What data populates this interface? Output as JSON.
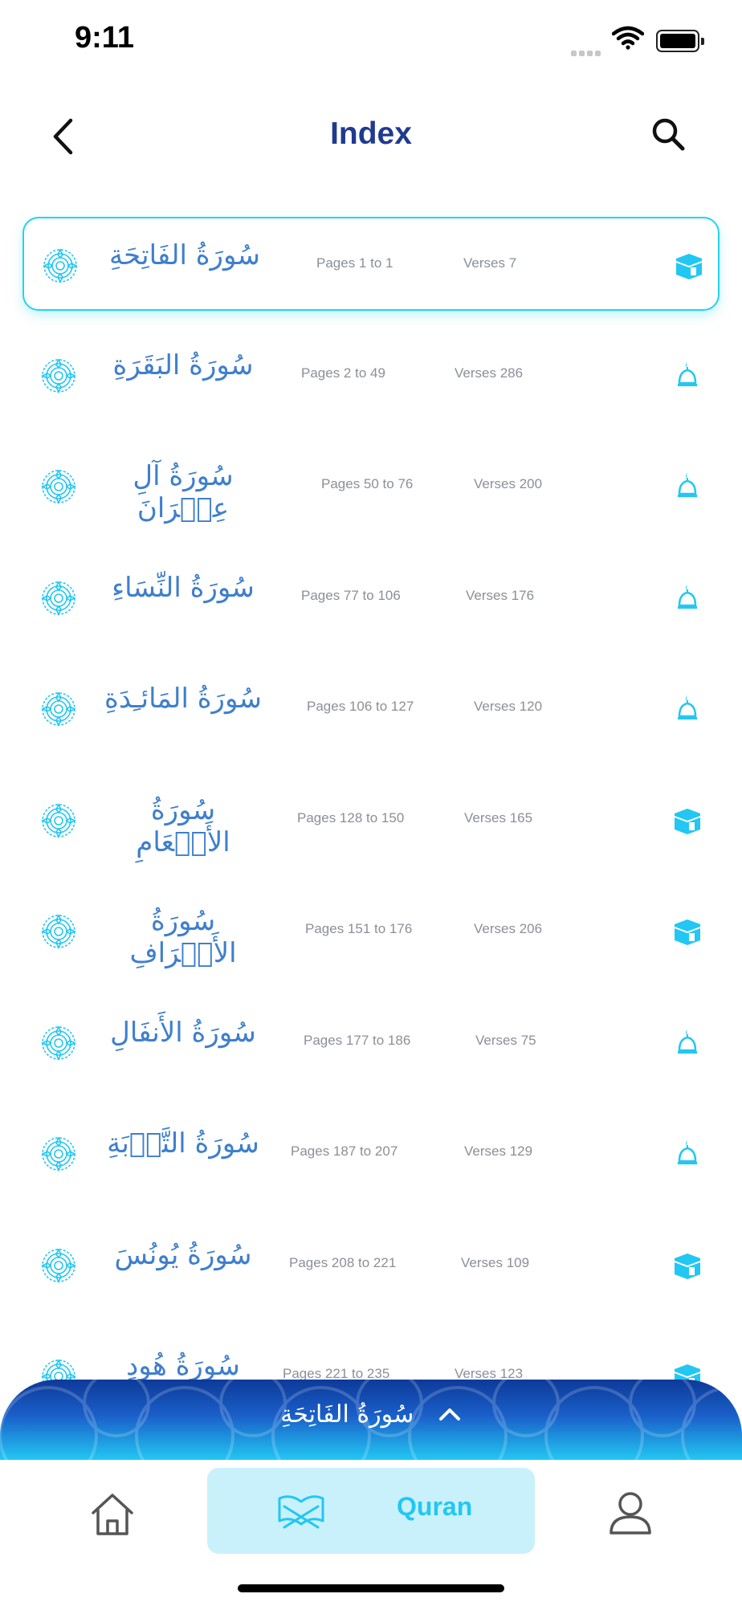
{
  "status_bar": {
    "time": "9:11"
  },
  "header": {
    "title": "Index"
  },
  "colors": {
    "accent": "#22c7f3",
    "title": "#1f3a8f",
    "surah_name": "#3f7fcc",
    "meta": "#8a8f98"
  },
  "surahs": [
    {
      "name": "سُورَةُ الفَاتِحَةِ",
      "pages": "Pages 1 to 1",
      "verses": "Verses 7",
      "place_icon": "kaaba-icon",
      "selected": true
    },
    {
      "name": "سُورَةُ البَقَرَةِ",
      "pages": "Pages 2 to 49",
      "verses": "Verses 286",
      "place_icon": "mosque-dome-icon"
    },
    {
      "name": "سُورَةُ آلِ عِمۡرَانَ",
      "pages": "Pages 50 to 76",
      "verses": "Verses 200",
      "place_icon": "mosque-dome-icon"
    },
    {
      "name": "سُورَةُ النِّسَاءِ",
      "pages": "Pages 77 to 106",
      "verses": "Verses 176",
      "place_icon": "mosque-dome-icon"
    },
    {
      "name": "سُورَةُ المَائـِدَةِ",
      "pages": "Pages 106 to 127",
      "verses": "Verses 120",
      "place_icon": "mosque-dome-icon"
    },
    {
      "name": "سُورَةُ الأَنۡعَامِ",
      "pages": "Pages 128 to 150",
      "verses": "Verses 165",
      "place_icon": "kaaba-icon"
    },
    {
      "name": "سُورَةُ الأَعۡرَافِ",
      "pages": "Pages 151 to 176",
      "verses": "Verses 206",
      "place_icon": "kaaba-icon"
    },
    {
      "name": "سُورَةُ الأَنفَالِ",
      "pages": "Pages 177 to 186",
      "verses": "Verses 75",
      "place_icon": "mosque-dome-icon"
    },
    {
      "name": "سُورَةُ التَّوۡبَةِ",
      "pages": "Pages 187 to 207",
      "verses": "Verses 129",
      "place_icon": "mosque-dome-icon"
    },
    {
      "name": "سُورَةُ يُونُسَ",
      "pages": "Pages 208 to 221",
      "verses": "Verses 109",
      "place_icon": "kaaba-icon"
    },
    {
      "name": "سُورَةُ هُودٍ",
      "pages": "Pages 221 to 235",
      "verses": "Verses 123",
      "place_icon": "kaaba-icon"
    }
  ],
  "now_reading": {
    "title": "سُورَةُ الفَاتِحَةِ"
  },
  "tabbar": {
    "quran_label": "Quran"
  }
}
